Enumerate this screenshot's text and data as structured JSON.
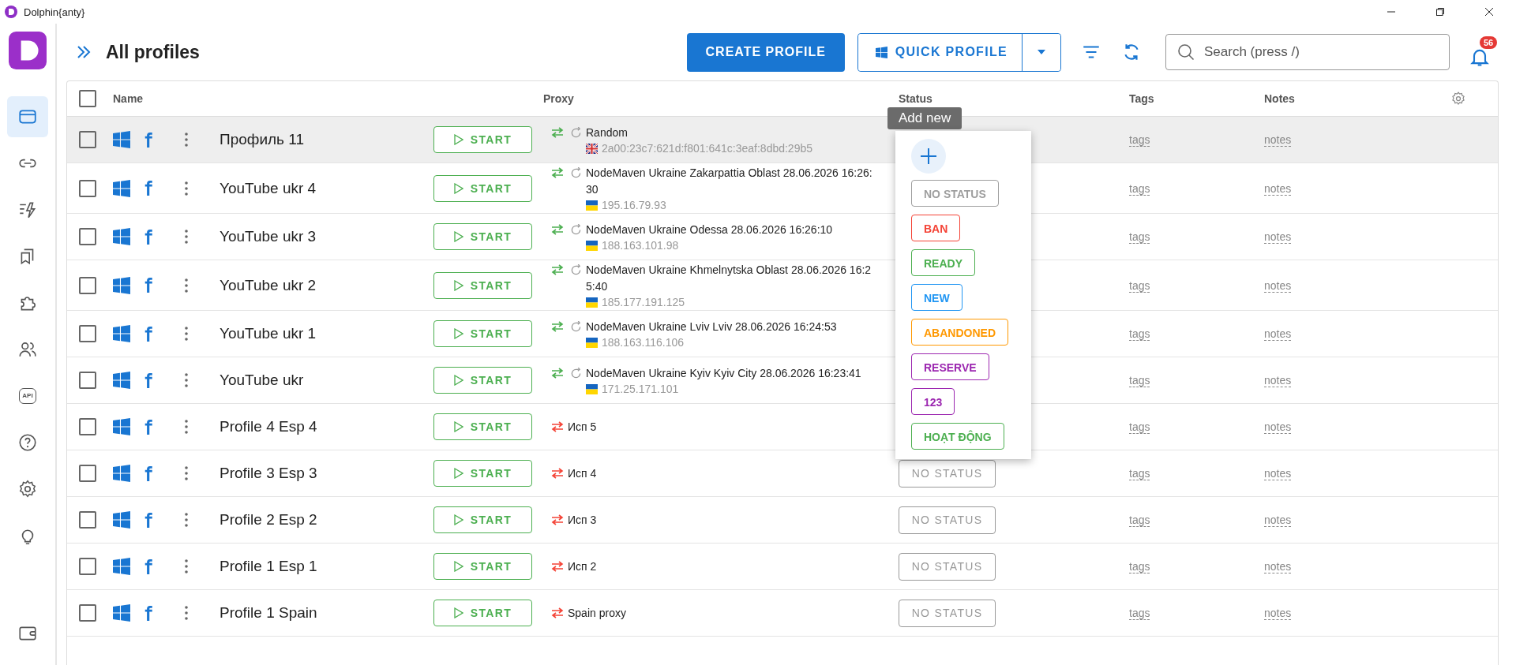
{
  "window": {
    "title": "Dolphin{anty}"
  },
  "sidebar": {
    "items": [
      {
        "kind": "browser",
        "selected": true
      },
      {
        "kind": "link",
        "selected": false
      },
      {
        "kind": "automation",
        "selected": false
      },
      {
        "kind": "bookmarks",
        "selected": false
      },
      {
        "kind": "extensions",
        "selected": false
      },
      {
        "kind": "users",
        "selected": false
      },
      {
        "kind": "api",
        "label": "API",
        "selected": false
      },
      {
        "kind": "help",
        "selected": false
      },
      {
        "kind": "settings",
        "selected": false
      },
      {
        "kind": "idea",
        "selected": false
      },
      {
        "kind": "wallet",
        "selected": false
      }
    ]
  },
  "header": {
    "title": "All profiles",
    "create_button": "CREATE PROFILE",
    "quick_button": "QUICK PROFILE",
    "search": {
      "placeholder": "Search (press /)"
    },
    "notifications": "56"
  },
  "table": {
    "columns": [
      "Name",
      "Proxy",
      "Status",
      "Tags",
      "Notes"
    ],
    "all_checked": false,
    "rows": [
      {
        "checked": false,
        "selected": true,
        "name": "Профиль 11",
        "start": "START",
        "proxy": {
          "kind": "rotating",
          "name": "Random",
          "flag": {
            "kind": "gb"
          },
          "ip": "2a00:23c7:621d:f801:641c:3eaf:8dbd:29b5"
        },
        "tags": "tags",
        "notes": "notes"
      },
      {
        "checked": false,
        "selected": false,
        "name": "YouTube ukr 4",
        "start": "START",
        "proxy": {
          "kind": "rotating",
          "name": "NodeMaven Ukraine Zakarpattia Oblast 28.06.2026 16:26:30",
          "flag": {
            "kind": "ua"
          },
          "ip": "195.16.79.93"
        },
        "tags": "tags",
        "notes": "notes"
      },
      {
        "checked": false,
        "selected": false,
        "name": "YouTube ukr 3",
        "start": "START",
        "proxy": {
          "kind": "rotating",
          "name": "NodeMaven Ukraine Odessa 28.06.2026 16:26:10",
          "flag": {
            "kind": "ua"
          },
          "ip": "188.163.101.98"
        },
        "tags": "tags",
        "notes": "notes"
      },
      {
        "checked": false,
        "selected": false,
        "name": "YouTube ukr 2",
        "start": "START",
        "proxy": {
          "kind": "rotating",
          "name": "NodeMaven Ukraine Khmelnytska Oblast 28.06.2026 16:25:40",
          "flag": {
            "kind": "ua"
          },
          "ip": "185.177.191.125"
        },
        "tags": "tags",
        "notes": "notes"
      },
      {
        "checked": false,
        "selected": false,
        "name": "YouTube ukr 1",
        "start": "START",
        "proxy": {
          "kind": "rotating",
          "name": "NodeMaven Ukraine Lviv Lviv 28.06.2026 16:24:53",
          "flag": {
            "kind": "ua"
          },
          "ip": "188.163.116.106"
        },
        "tags": "tags",
        "notes": "notes"
      },
      {
        "checked": false,
        "selected": false,
        "name": "YouTube ukr",
        "start": "START",
        "proxy": {
          "kind": "rotating",
          "name": "NodeMaven Ukraine Kyiv Kyiv City 28.06.2026 16:23:41",
          "flag": {
            "kind": "ua"
          },
          "ip": "171.25.171.101"
        },
        "tags": "tags",
        "notes": "notes"
      },
      {
        "checked": false,
        "selected": false,
        "name": "Profile 4 Esp 4",
        "start": "START",
        "proxy": {
          "kind": "static",
          "name": "Исп 5"
        },
        "tags": "tags",
        "notes": "notes"
      },
      {
        "checked": false,
        "selected": false,
        "name": "Profile 3 Esp 3",
        "start": "START",
        "proxy": {
          "kind": "static",
          "name": "Исп 4"
        },
        "status": "NO STATUS",
        "tags": "tags",
        "notes": "notes"
      },
      {
        "checked": false,
        "selected": false,
        "name": "Profile 2 Esp 2",
        "start": "START",
        "proxy": {
          "kind": "static",
          "name": "Исп 3"
        },
        "status": "NO STATUS",
        "tags": "tags",
        "notes": "notes"
      },
      {
        "checked": false,
        "selected": false,
        "name": "Profile 1 Esp 1",
        "start": "START",
        "proxy": {
          "kind": "static",
          "name": "Исп 2"
        },
        "status": "NO STATUS",
        "tags": "tags",
        "notes": "notes"
      },
      {
        "checked": false,
        "selected": false,
        "name": "Profile 1 Spain",
        "start": "START",
        "proxy": {
          "kind": "static",
          "name": "Spain proxy"
        },
        "status": "NO STATUS",
        "tags": "tags",
        "notes": "notes"
      }
    ]
  },
  "status_menu": {
    "tooltip": "Add new",
    "items": [
      {
        "label": "NO STATUS",
        "color": "#9e9e9e"
      },
      {
        "label": "BAN",
        "color": "#f44336"
      },
      {
        "label": "READY",
        "color": "#4caf50"
      },
      {
        "label": "NEW",
        "color": "#2196f3"
      },
      {
        "label": "ABANDONED",
        "color": "#ff9800"
      },
      {
        "label": "RESERVE",
        "color": "#9c27b0"
      },
      {
        "label": "123",
        "color": "#9c27b0"
      },
      {
        "label": "HOẠT ĐỘNG",
        "color": "#4caf50"
      }
    ]
  }
}
